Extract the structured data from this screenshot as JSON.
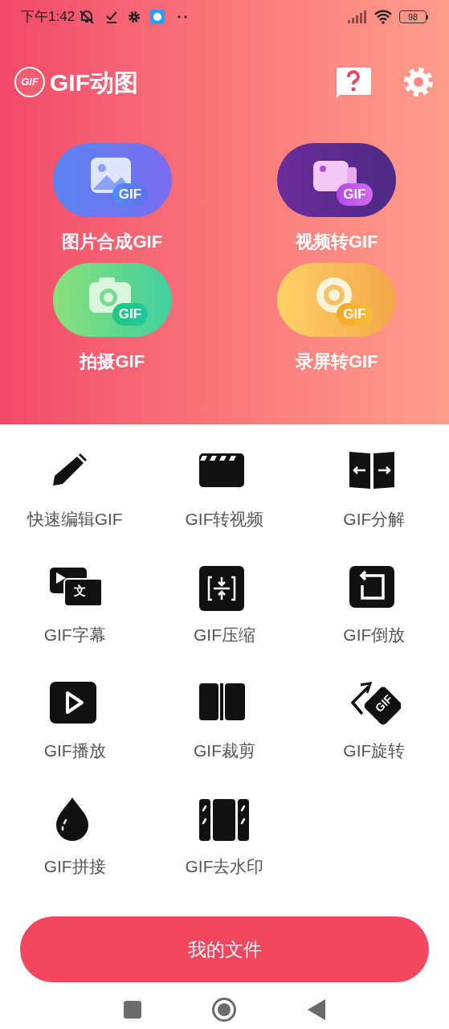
{
  "status_bar": {
    "time": "下午1:42",
    "battery": "98"
  },
  "app_bar": {
    "logo_text": "GIF",
    "title": "GIF动图"
  },
  "features": [
    {
      "kind": "image",
      "badge": "GIF",
      "label": "图片合成GIF"
    },
    {
      "kind": "video",
      "badge": "GIF",
      "label": "视频转GIF"
    },
    {
      "kind": "camera",
      "badge": "GIF",
      "label": "拍摄GIF"
    },
    {
      "kind": "record",
      "badge": "GIF",
      "label": "录屏转GIF"
    }
  ],
  "tools": [
    {
      "kind": "pencil",
      "label": "快速编辑GIF"
    },
    {
      "kind": "clapper",
      "label": "GIF转视频"
    },
    {
      "kind": "split",
      "label": "GIF分解"
    },
    {
      "kind": "subtitle",
      "label": "GIF字幕",
      "icon_text": "文"
    },
    {
      "kind": "compress",
      "label": "GIF压缩"
    },
    {
      "kind": "reverse",
      "label": "GIF倒放"
    },
    {
      "kind": "play",
      "label": "GIF播放"
    },
    {
      "kind": "crop",
      "label": "GIF裁剪"
    },
    {
      "kind": "rotate",
      "label": "GIF旋转",
      "icon_text": "GIF"
    },
    {
      "kind": "drop",
      "label": "GIF拼接"
    },
    {
      "kind": "watermark",
      "label": "GIF去水印"
    }
  ],
  "primary_button": "我的文件"
}
